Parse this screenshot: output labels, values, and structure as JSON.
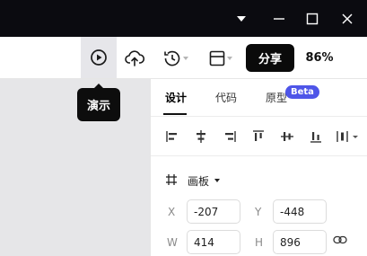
{
  "titlebar": {
    "icons": [
      "caret-down-icon",
      "minimize-icon",
      "maximize-icon",
      "close-icon"
    ]
  },
  "toolbar": {
    "icons": [
      "play-icon",
      "upload-cloud-icon",
      "history-icon",
      "layout-icon"
    ],
    "share_label": "分享",
    "zoom_label": "86%"
  },
  "tooltip": {
    "text": "演示"
  },
  "panel": {
    "tabs": [
      {
        "label": "设计",
        "active": true
      },
      {
        "label": "代码",
        "active": false
      },
      {
        "label": "原型",
        "active": false
      }
    ],
    "beta_badge": "Beta",
    "align_icons": [
      "align-left-icon",
      "align-center-horizontal-icon",
      "align-right-icon",
      "align-top-icon",
      "align-middle-vertical-icon",
      "align-bottom-icon",
      "distribute-icon"
    ],
    "frame": {
      "label": "画板"
    },
    "fields": {
      "x_label": "X",
      "x_value": "-207",
      "y_label": "Y",
      "y_value": "-448",
      "w_label": "W",
      "w_value": "414",
      "h_label": "H",
      "h_value": "896"
    }
  },
  "colors": {
    "titlebar": "#0b0b10",
    "canvas": "#e6e6e8",
    "accent_beta": "#4e55e8",
    "share_button": "#0a0a0a"
  }
}
